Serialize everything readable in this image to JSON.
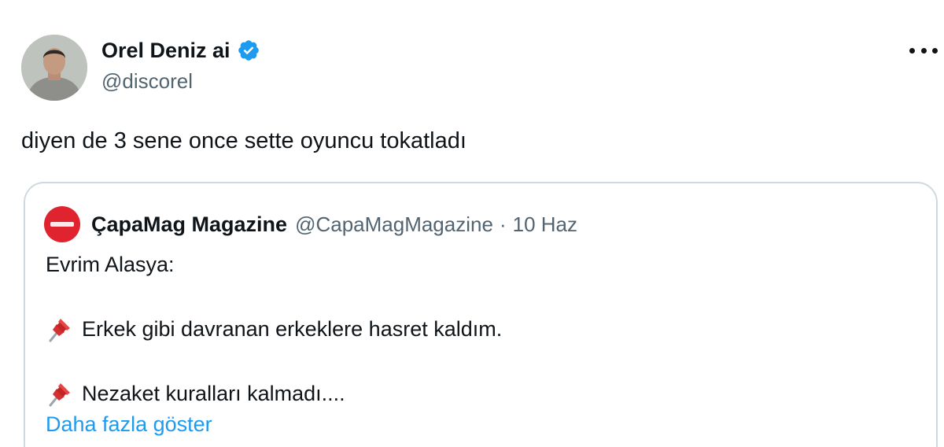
{
  "tweet": {
    "author": {
      "display_name": "Orel Deniz ai",
      "handle": "@discorel",
      "verified_icon": "verified-badge-icon",
      "avatar": "avatar"
    },
    "more_icon": "more-options-icon",
    "text": "diyen de 3 sene once sette oyuncu tokatladı"
  },
  "quote": {
    "author": {
      "display_name": "ÇapaMag Magazine",
      "handle": "@CapaMagMagazine",
      "separator": "·",
      "time": "10 Haz"
    },
    "lines": [
      "Evrim Alasya:",
      "Erkek gibi davranan erkeklere hasret kaldım.",
      "Nezaket kuralları kalmadı...."
    ],
    "pin_icon": "pushpin-icon",
    "show_more": "Daha fazla göster"
  },
  "colors": {
    "text": "#0f1419",
    "secondary": "#536471",
    "link": "#1d9bf0",
    "verified": "#1d9bf0",
    "border": "#cfd9de",
    "quote_avatar": "#e0242f"
  }
}
